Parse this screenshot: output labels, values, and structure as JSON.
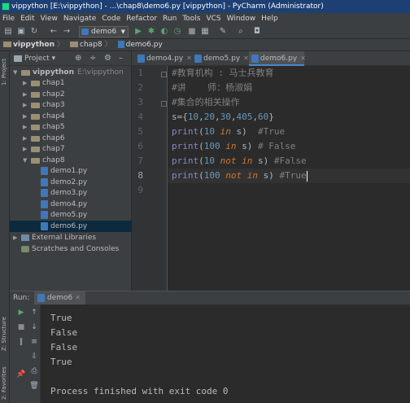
{
  "window": {
    "title": "vippython [E:\\vippython] - ...\\chap8\\demo6.py [vippython] - PyCharm (Administrator)"
  },
  "menu": [
    "File",
    "Edit",
    "View",
    "Navigate",
    "Code",
    "Refactor",
    "Run",
    "Tools",
    "VCS",
    "Window",
    "Help"
  ],
  "toolbar": {
    "run_config": "demo6",
    "icons": [
      "open-icon",
      "save-icon",
      "sync-icon",
      "back-icon",
      "forward-icon",
      "run-config-dropdown",
      "run-icon",
      "debug-icon",
      "coverage-icon",
      "profile-icon",
      "stop-icon",
      "build-icon",
      "settings-icon",
      "search-icon",
      "plugin-icon"
    ]
  },
  "navbar": {
    "crumbs": [
      "vippython",
      "chap8",
      "demo6.py"
    ]
  },
  "side_strip": {
    "project_label": "1: Project",
    "structure_label": "Z: Structure",
    "favorites_label": "2: Favorites"
  },
  "project": {
    "title": "Project",
    "root_name": "vippython",
    "root_path": "E:\\vippython",
    "folders": [
      "chap1",
      "chap2",
      "chap3",
      "chap4",
      "chap5",
      "chap6",
      "chap7",
      "chap8"
    ],
    "files": [
      "demo1.py",
      "demo2.py",
      "demo3.py",
      "demo4.py",
      "demo5.py",
      "demo6.py"
    ],
    "selected_file": "demo6.py",
    "external": "External Libraries",
    "scratches": "Scratches and Consoles"
  },
  "editor": {
    "tabs": [
      {
        "name": "demo4.py",
        "active": false
      },
      {
        "name": "demo5.py",
        "active": false
      },
      {
        "name": "demo6.py",
        "active": true
      }
    ],
    "line_numbers": [
      "1",
      "2",
      "3",
      "4",
      "5",
      "6",
      "7",
      "8",
      "9"
    ],
    "current_line": 8,
    "lines": {
      "l1": "#教育机构 : 马士兵教育",
      "l2": "#讲    师：杨淑娟",
      "l3": "#集合的相关操作",
      "l4_var": "s",
      "l4_eq": "=",
      "l4_open": "{",
      "l4_n1": "10",
      "l4_n2": "20",
      "l4_n3": "30",
      "l4_n4": "405",
      "l4_n5": "60",
      "l4_close": "}",
      "l5_fn": "print",
      "l5_num": "10",
      "l5_kw": "in",
      "l5_cm": "#True",
      "l6_fn": "print",
      "l6_num": "100",
      "l6_kw": "in",
      "l6_cm": "# False",
      "l7_fn": "print",
      "l7_num": "10",
      "l7_kw": "not in",
      "l7_cm": "#False",
      "l8_fn": "print",
      "l8_num": "100",
      "l8_kw": "not in",
      "l8_cm": "#True"
    }
  },
  "run": {
    "label": "Run:",
    "tab": "demo6",
    "output": [
      "True",
      "False",
      "False",
      "True",
      "",
      "Process finished with exit code 0"
    ]
  }
}
